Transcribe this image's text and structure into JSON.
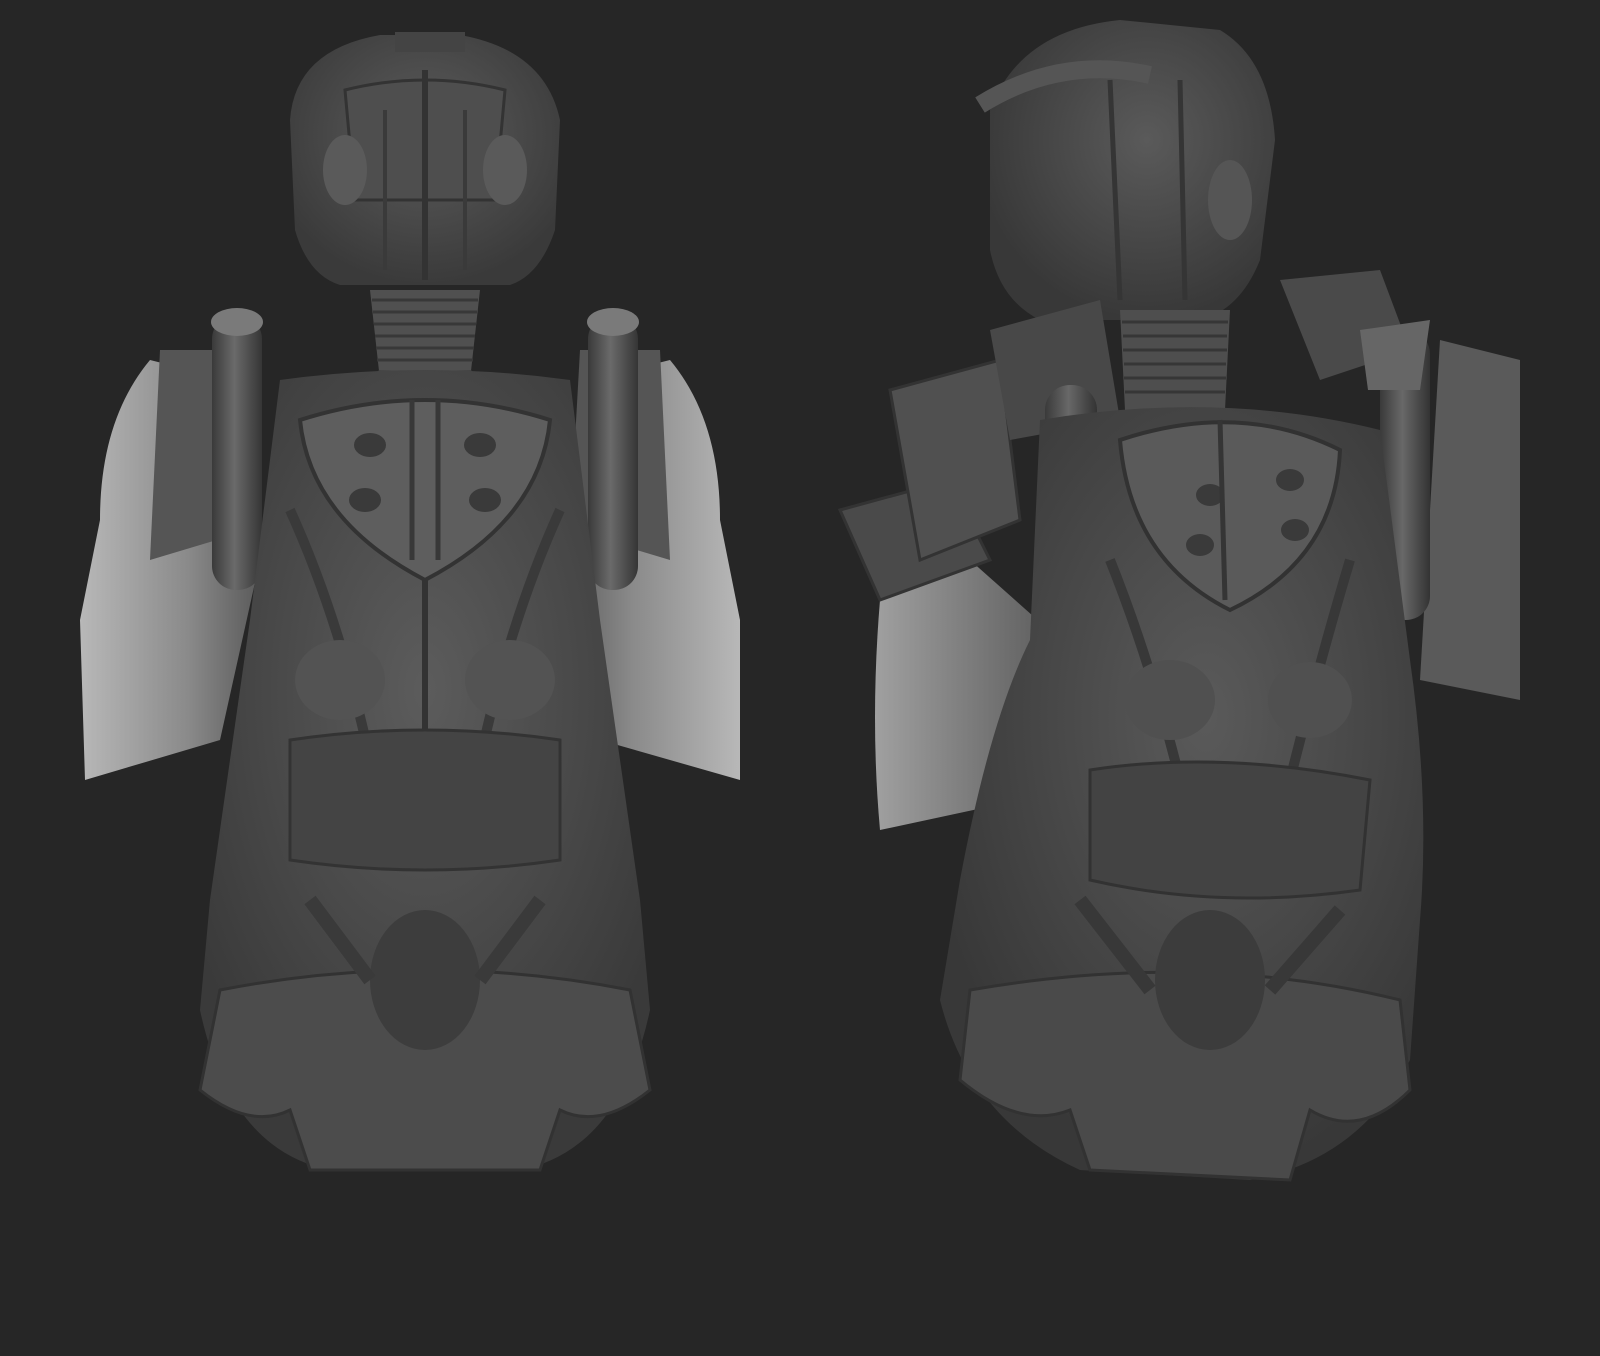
{
  "scene": {
    "background_color": "#262626",
    "model_base_color": "#4a4a4a",
    "model_highlight_color": "#9a9a9a",
    "model_shadow_color": "#2e2e2e",
    "views": [
      {
        "id": "front",
        "label": ""
      },
      {
        "id": "three-quarter",
        "label": ""
      }
    ]
  }
}
